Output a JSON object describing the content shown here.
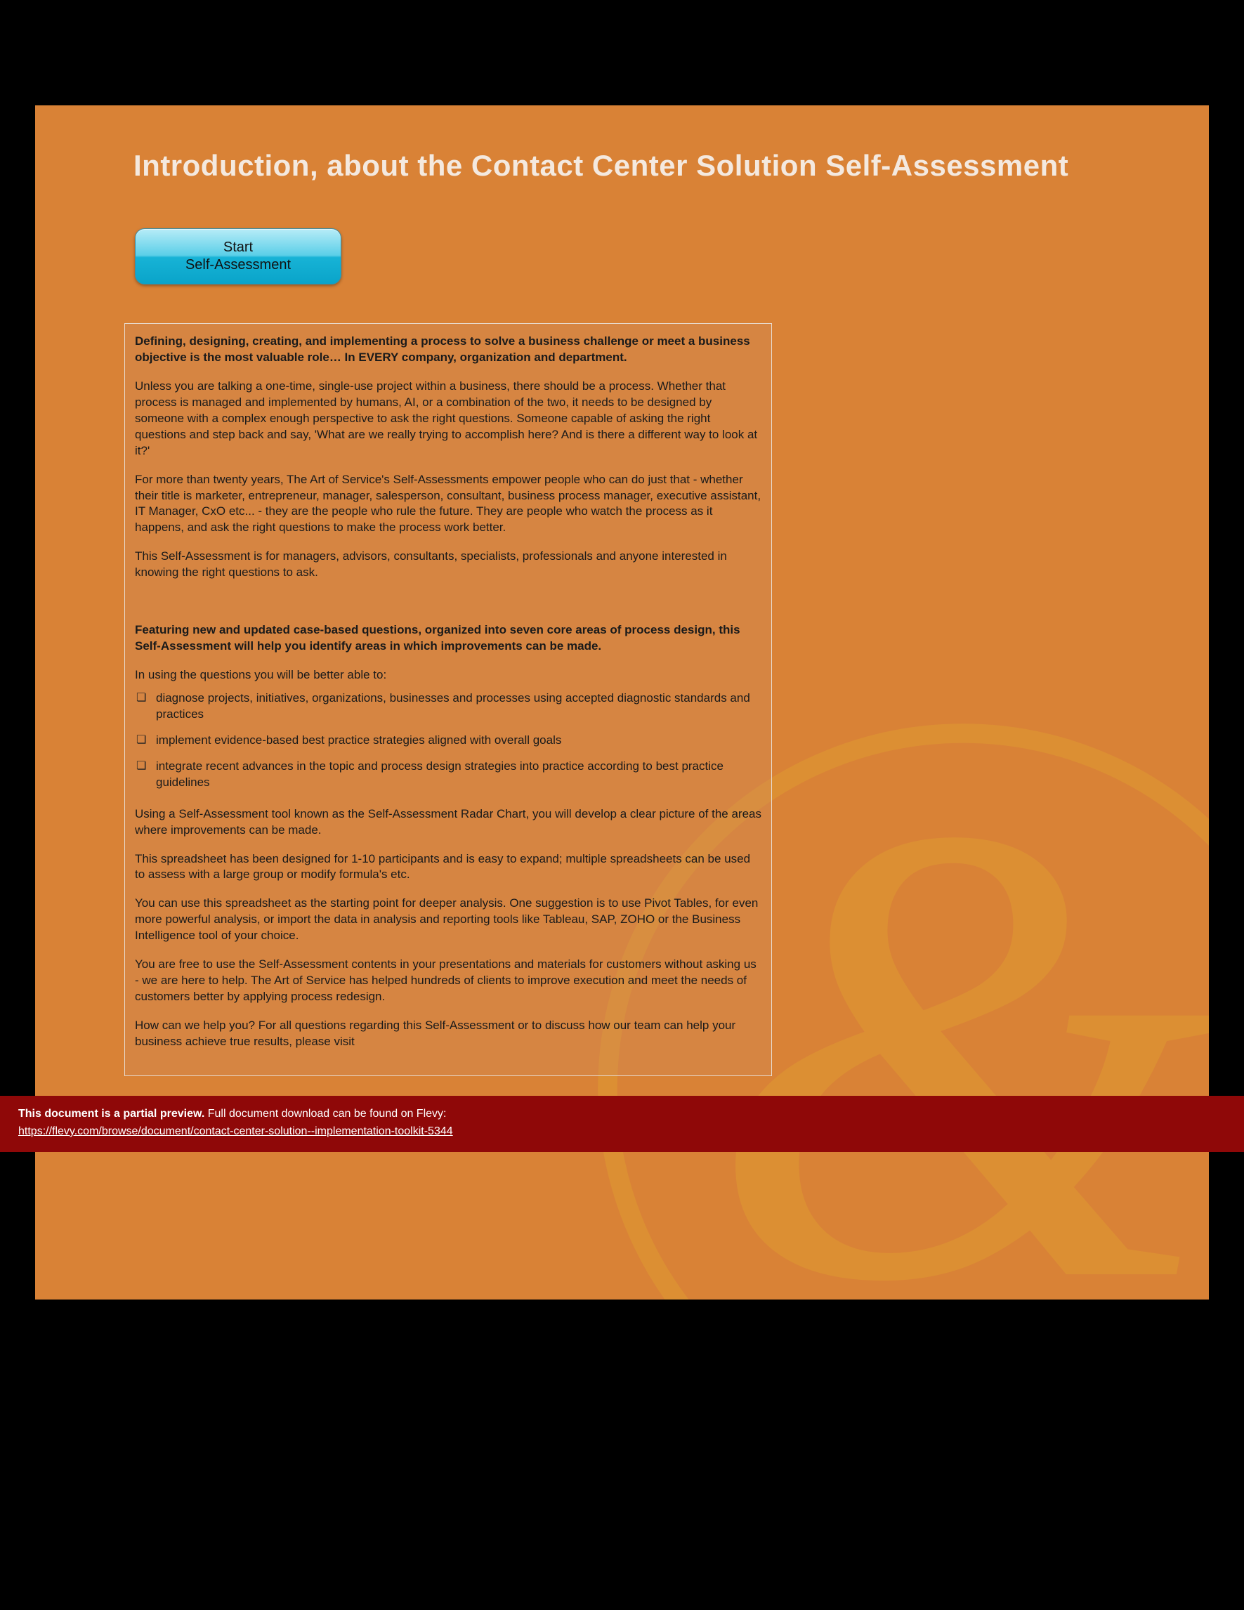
{
  "title": "Introduction, about the Contact Center Solution Self-Assessment",
  "start_button": {
    "line1": "Start",
    "line2": "Self-Assessment"
  },
  "intro_bold": "Defining, designing, creating, and implementing a process to solve a business challenge or meet a business objective is the most valuable role… In EVERY company, organization and department.",
  "p1": "Unless you are talking a one-time, single-use project within a business, there should be a process. Whether that process is managed and implemented by humans, AI, or a combination of the two, it needs to be designed by someone with a complex enough perspective to ask the right questions. Someone capable of asking the right questions and step back and say, 'What are we really trying to accomplish here? And is there a different way to look at it?'",
  "p2": "For more than twenty years, The Art of Service's Self-Assessments empower people who can do just that - whether their title is marketer, entrepreneur, manager, salesperson, consultant, business process manager, executive assistant, IT Manager, CxO etc... - they are the people who rule the future. They are people who watch the process as it happens, and ask the right questions to make the process work better.",
  "p3": "This Self-Assessment is for managers, advisors, consultants, specialists, professionals and anyone interested in knowing the right questions to ask.",
  "feature_bold": "Featuring new and updated case-based questions, organized into seven core areas of process design, this Self-Assessment will help you identify areas in which improvements can be made.",
  "lead_in": "In using the questions you will be better able to:",
  "bullets": [
    "diagnose projects, initiatives, organizations, businesses and processes using accepted diagnostic standards and practices",
    "implement evidence-based best practice strategies aligned with overall goals",
    "integrate recent advances in the topic and process design strategies into practice according to best practice guidelines"
  ],
  "p4": "Using a Self-Assessment tool known as the Self-Assessment Radar Chart, you will develop a clear picture of the areas where improvements can be made.",
  "p5": "This spreadsheet has been designed for 1-10 participants and is easy to expand; multiple spreadsheets can be used to assess with a large group or modify formula's etc.",
  "p6": "You can use this spreadsheet as the starting point for deeper analysis. One suggestion is to use Pivot Tables, for even more powerful analysis, or import the data in analysis and reporting tools like Tableau, SAP, ZOHO or the Business Intelligence tool of your choice.",
  "p7": "You are free to use the Self-Assessment contents in your presentations and materials for customers without asking us - we are here to help. The Art of Service has helped hundreds of clients to improve execution and meet the needs of customers better by applying process redesign.",
  "p8": "How can we help you? For all questions regarding this Self-Assessment or to discuss how our team can help your business achieve true results, please visit",
  "banner": {
    "lead_bold": "This document is a partial preview.",
    "lead_rest": "  Full document download can be found on Flevy:",
    "url": "https://flevy.com/browse/document/contact-center-solution--implementation-toolkit-5344"
  }
}
